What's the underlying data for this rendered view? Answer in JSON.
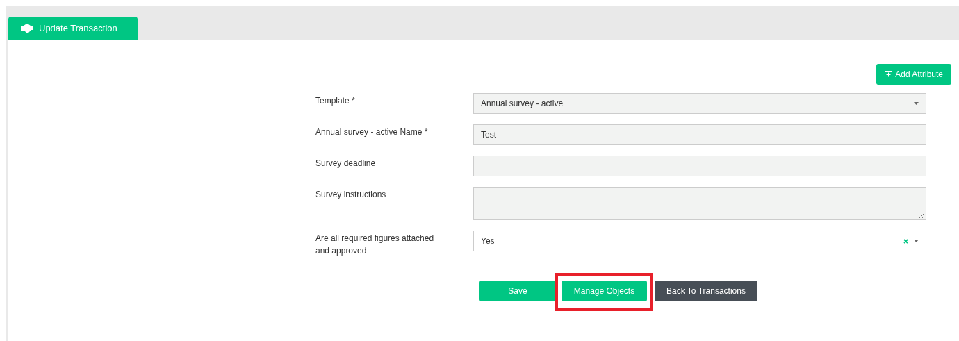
{
  "tab": {
    "label": "Update Transaction",
    "selected": true
  },
  "add_button": {
    "label": "Add Attribute"
  },
  "fields": [
    {
      "label": "Template *",
      "kind": "select",
      "value": "Annual survey - active",
      "clearable": false
    },
    {
      "label": "Annual survey - active Name *",
      "kind": "input",
      "value": "Test"
    },
    {
      "label": "Survey deadline",
      "kind": "input"
    },
    {
      "label": "Survey instructions",
      "kind": "textarea"
    },
    {
      "label": "Are all required figures attached and approved",
      "kind": "select",
      "value": "Yes",
      "clearable": true
    }
  ],
  "buttons": [
    {
      "label": "Save",
      "kind": "primary",
      "highlighted": false
    },
    {
      "label": "Manage Objects",
      "kind": "primary",
      "highlighted": true
    },
    {
      "label": "Back To Transactions",
      "kind": "dark",
      "highlighted": false
    }
  ]
}
